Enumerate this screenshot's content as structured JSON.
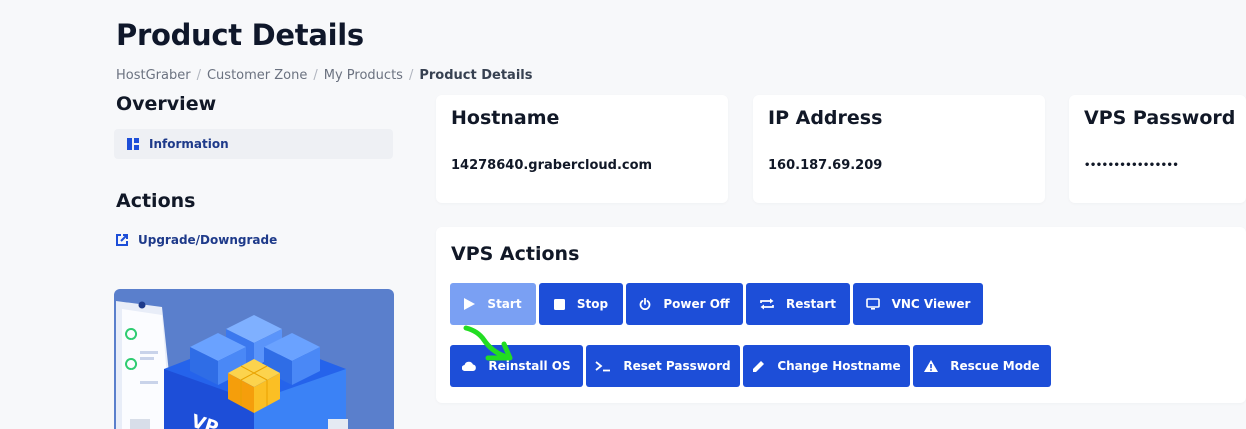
{
  "page": {
    "title": "Product Details"
  },
  "breadcrumb": {
    "items": [
      "HostGraber",
      "Customer Zone",
      "My Products"
    ],
    "separator": "/",
    "current": "Product Details"
  },
  "sidebar": {
    "overview_title": "Overview",
    "overview_items": [
      {
        "label": "Information",
        "icon": "dashboard-icon"
      }
    ],
    "actions_title": "Actions",
    "action_items": [
      {
        "label": "Upgrade/Downgrade",
        "icon": "external-link-icon"
      }
    ]
  },
  "info_cards": [
    {
      "title": "Hostname",
      "value": "14278640.grabercloud.com"
    },
    {
      "title": "IP Address",
      "value": "160.187.69.209"
    },
    {
      "title": "VPS Password",
      "value": "••••••••••••••••"
    }
  ],
  "vps_actions": {
    "title": "VPS Actions",
    "row1": [
      {
        "label": "Start",
        "icon": "play-icon",
        "state": "disabled"
      },
      {
        "label": "Stop",
        "icon": "stop-icon"
      },
      {
        "label": "Power Off",
        "icon": "power-icon"
      },
      {
        "label": "Restart",
        "icon": "restart-icon"
      },
      {
        "label": "VNC Viewer",
        "icon": "monitor-icon"
      }
    ],
    "row2": [
      {
        "label": "Reinstall OS",
        "icon": "cloud-icon"
      },
      {
        "label": "Reset Password",
        "icon": "terminal-icon"
      },
      {
        "label": "Change Hostname",
        "icon": "pencil-icon"
      },
      {
        "label": "Rescue Mode",
        "icon": "warning-icon"
      }
    ]
  },
  "colors": {
    "primary": "#1d4ed8",
    "primary_disabled": "#7aa0f3",
    "background": "#f7f8fa",
    "annotation_arrow": "#22dd22"
  }
}
